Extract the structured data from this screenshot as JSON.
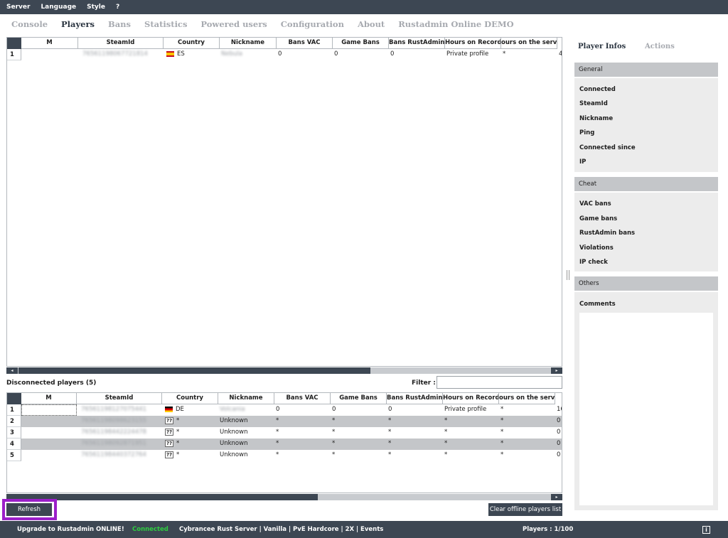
{
  "menu": [
    "Server",
    "Language",
    "Style",
    "?"
  ],
  "tabs": [
    {
      "label": "Console",
      "active": false
    },
    {
      "label": "Players",
      "active": true
    },
    {
      "label": "Bans",
      "active": false
    },
    {
      "label": "Statistics",
      "active": false
    },
    {
      "label": "Powered users",
      "active": false
    },
    {
      "label": "Configuration",
      "active": false
    },
    {
      "label": "About",
      "active": false
    },
    {
      "label": "Rustadmin Online DEMO",
      "active": false
    }
  ],
  "online": {
    "columns": [
      "M",
      "SteamId",
      "Country",
      "Nickname",
      "Bans VAC",
      "Game Bans",
      "Bans RustAdmin",
      "Hours on Record",
      "ours on the serv"
    ],
    "rows": [
      {
        "num": "1",
        "steamid": "76561198067721814",
        "flag": "es",
        "country": "ES",
        "nickname": "Nebula",
        "vac": "0",
        "game": "0",
        "ra": "0",
        "hours": "Private profile",
        "server": "*",
        "extra": "4"
      }
    ]
  },
  "disconnected": {
    "title": "Disconnected players (5)",
    "filter_label": "Filter :",
    "filter_value": "",
    "columns": [
      "M",
      "SteamId",
      "Country",
      "Nickname",
      "Bans VAC",
      "Game Bans",
      "Bans RustAdmin",
      "Hours on Record",
      "ours on the serv"
    ],
    "rows": [
      {
        "num": "1",
        "steamid": "76561198127075441",
        "flag": "de",
        "country": "DE",
        "nickname": "Volcania",
        "vac": "0",
        "game": "0",
        "ra": "0",
        "hours": "Private profile",
        "server": "*",
        "extra": "16",
        "shaded": false
      },
      {
        "num": "2",
        "steamid": "76561198098623155",
        "flag": "unknown",
        "country": "*",
        "nickname": "Unknown",
        "vac": "*",
        "game": "*",
        "ra": "*",
        "hours": "*",
        "server": "*",
        "extra": "0",
        "shaded": true
      },
      {
        "num": "3",
        "steamid": "76561198442224478",
        "flag": "unknown",
        "country": "*",
        "nickname": "Unknown",
        "vac": "*",
        "game": "*",
        "ra": "*",
        "hours": "*",
        "server": "*",
        "extra": "0",
        "shaded": false
      },
      {
        "num": "4",
        "steamid": "76561198092871951",
        "flag": "unknown",
        "country": "*",
        "nickname": "Unknown",
        "vac": "*",
        "game": "*",
        "ra": "*",
        "hours": "*",
        "server": "*",
        "extra": "0",
        "shaded": true
      },
      {
        "num": "5",
        "steamid": "76561198440372764",
        "flag": "unknown",
        "country": "*",
        "nickname": "Unknown",
        "vac": "*",
        "game": "*",
        "ra": "*",
        "hours": "*",
        "server": "*",
        "extra": "0",
        "shaded": false
      }
    ],
    "unknown_flag": "??"
  },
  "buttons": {
    "refresh": "Refresh",
    "clear": "Clear offline players list"
  },
  "scroll_buttons": {
    "left": "◂",
    "right": "▸"
  },
  "panel": {
    "tabs": [
      "Player Infos",
      "Actions"
    ],
    "general": {
      "title": "General",
      "items": [
        "Connected",
        "SteamId",
        "Nickname",
        "Ping",
        "Connected since",
        "IP"
      ]
    },
    "cheat": {
      "title": "Cheat",
      "items": [
        "VAC bans",
        "Game bans",
        "RustAdmin bans",
        "Violations",
        "IP check"
      ]
    },
    "others": {
      "title": "Others",
      "items": [
        "Comments"
      ]
    }
  },
  "status": {
    "upgrade": "Upgrade to Rustadmin ONLINE!",
    "connection": "Connected",
    "server_name": "Cybrancee Rust Server | Vanilla | PvE Hardcore | 2X | Events",
    "players": "Players : 1/100",
    "info_icon": "i"
  },
  "colors": {
    "accent": "#3d4753",
    "connected": "#2ecc40",
    "highlight": "#9b1fc9",
    "row_shade": "#c4c6c9"
  }
}
